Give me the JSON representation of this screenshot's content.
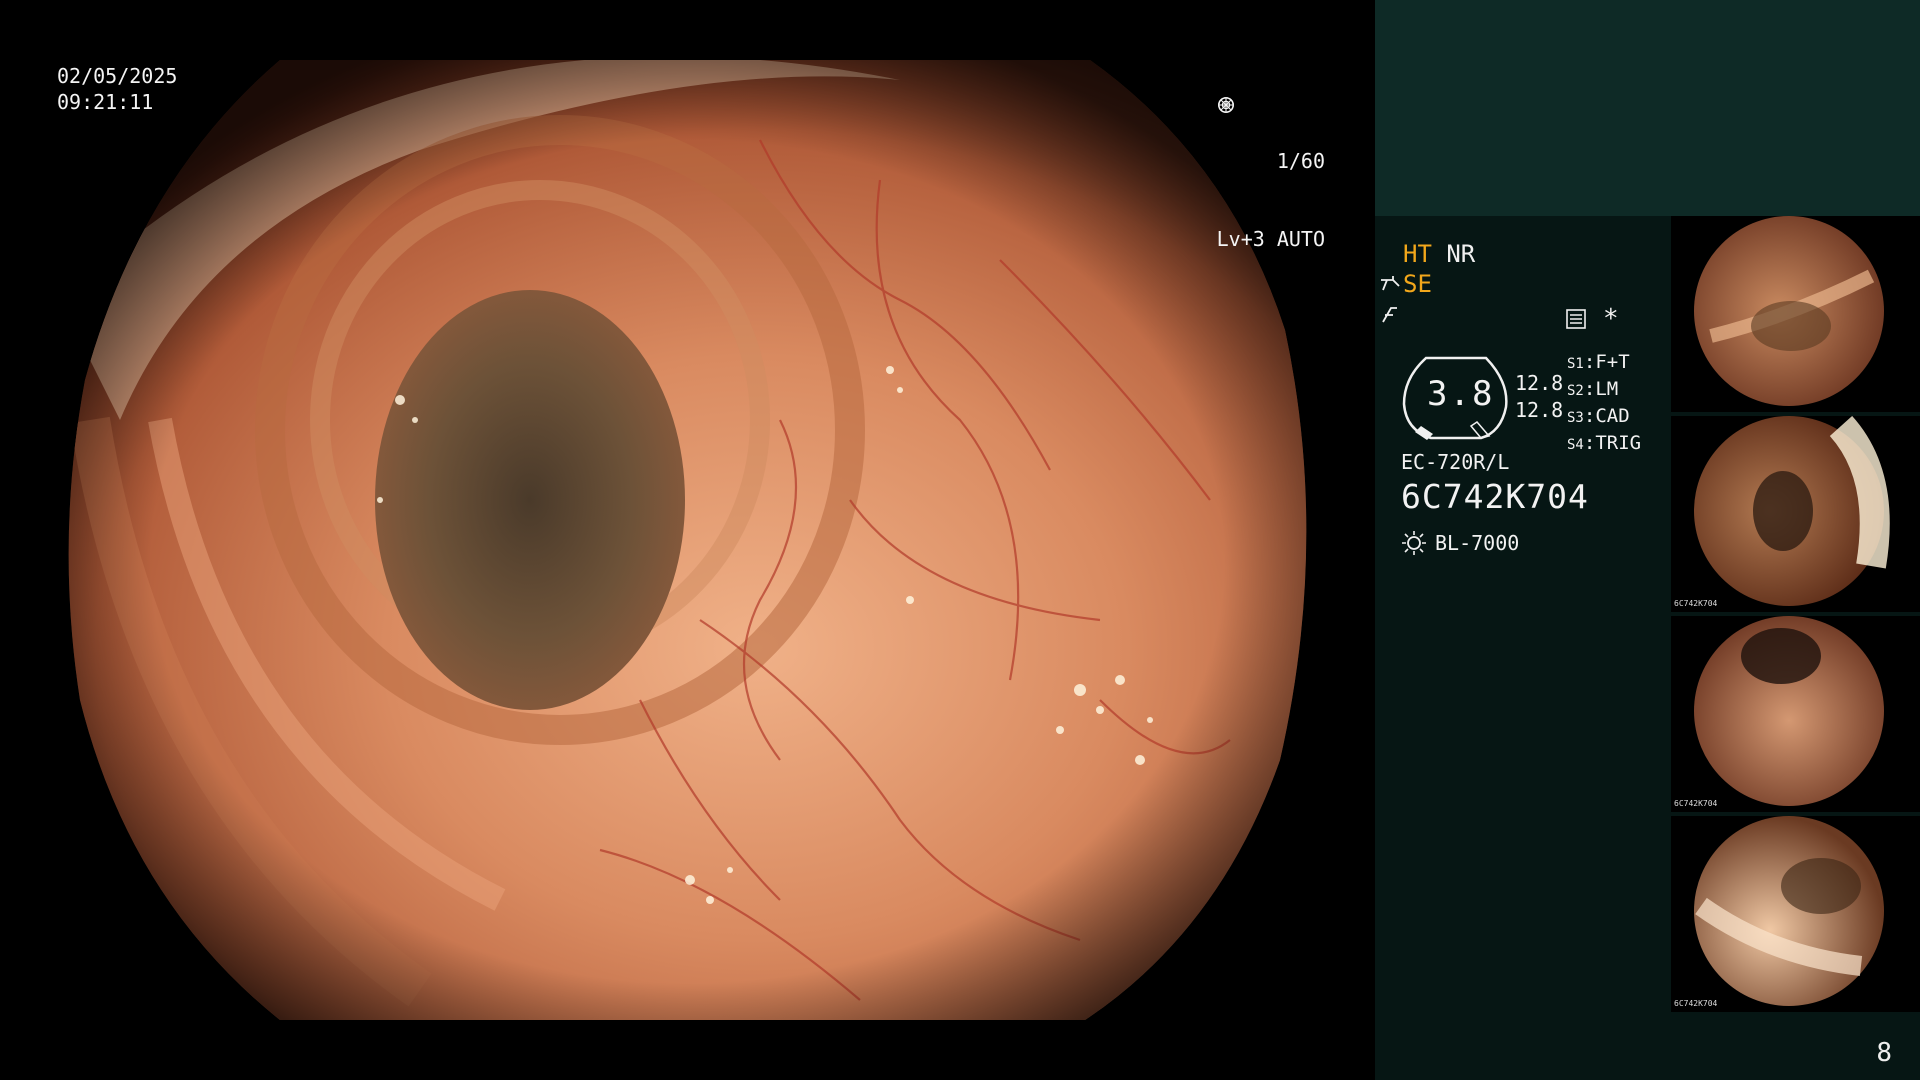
{
  "main_view": {
    "date": "02/05/2025",
    "time": "09:21:11",
    "shutter": "1/60",
    "exposure": "Lv+3 AUTO"
  },
  "panel": {
    "mode_ht": "HT",
    "mode_nr": "NR",
    "mode_se": "SE",
    "asterisk": "*",
    "ring_value": "3.8",
    "side_value_1": "12.8",
    "side_value_2": "12.8",
    "slots": [
      {
        "key": "S1",
        "label": "F+T"
      },
      {
        "key": "S2",
        "label": "LM"
      },
      {
        "key": "S3",
        "label": "CAD"
      },
      {
        "key": "S4",
        "label": "TRIG"
      }
    ],
    "scope_model": "EC-720R/L",
    "serial": "6C742K704",
    "light_source": "BL-7000",
    "accent_color": "#f2a71b",
    "page_number": "8"
  },
  "thumbnails": [
    {
      "serial": "",
      "note": ""
    },
    {
      "serial": "6C742K704"
    },
    {
      "serial": "6C742K704"
    },
    {
      "serial": "6C742K704"
    }
  ],
  "icons": [
    "shutter-icon",
    "auto-iris-icon",
    "scope-angle-icon",
    "freeze-icon",
    "menu-icon",
    "light-source-icon"
  ]
}
